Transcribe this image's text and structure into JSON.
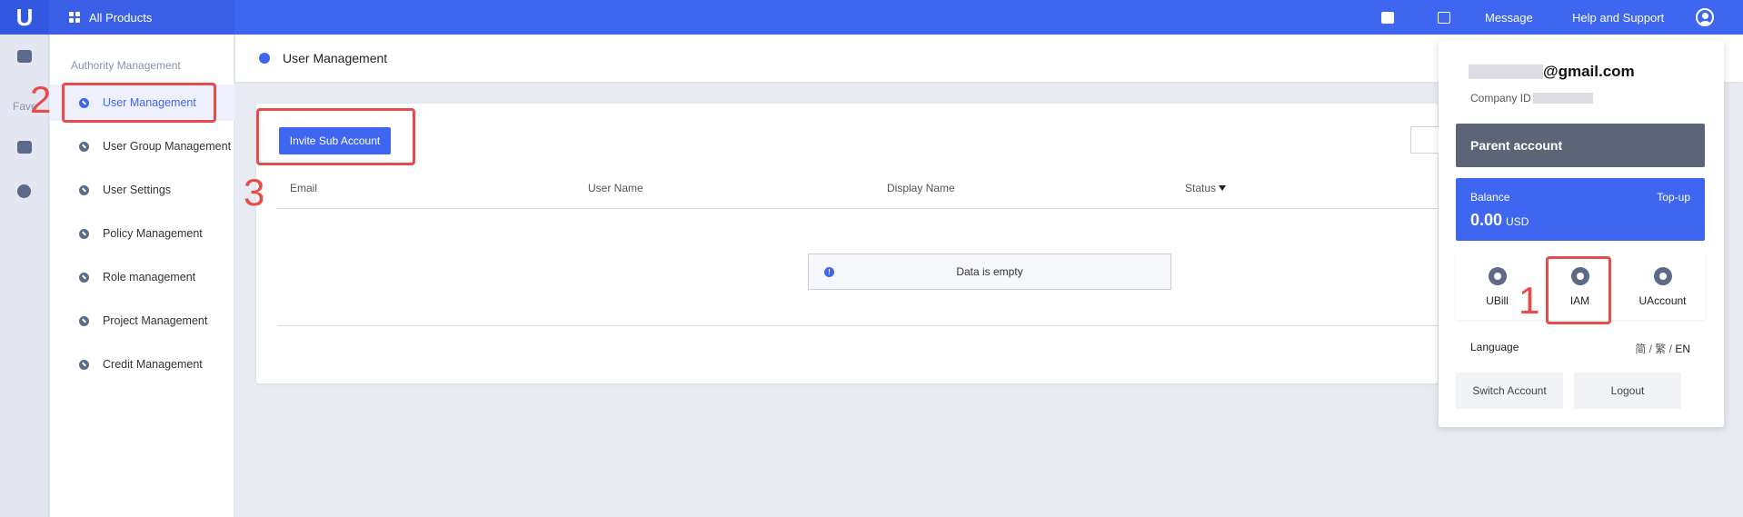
{
  "topbar": {
    "all_products": "All Products",
    "message": "Message",
    "help": "Help and Support",
    "icons": [
      "search-icon",
      "terminal-icon",
      "user-icon"
    ]
  },
  "rail": {
    "fav_label": "Fave"
  },
  "sidebar": {
    "title": "Authority Management",
    "items": [
      {
        "label": "User Management"
      },
      {
        "label": "User Group Management"
      },
      {
        "label": "User Settings"
      },
      {
        "label": "Policy Management"
      },
      {
        "label": "Role management"
      },
      {
        "label": "Project Management"
      },
      {
        "label": "Credit Management"
      }
    ]
  },
  "main": {
    "title": "User Management",
    "invite_button": "Invite Sub Account",
    "columns": [
      "Email",
      "User Name",
      "Display Name",
      "Status"
    ],
    "empty_text": "Data is empty"
  },
  "account_panel": {
    "email_suffix": "@gmail.com",
    "company_label": "Company ID",
    "parent_account": "Parent account",
    "balance_label": "Balance",
    "topup_label": "Top-up",
    "balance_amount": "0.00",
    "balance_currency": "USD",
    "services": [
      {
        "label": "UBill"
      },
      {
        "label": "IAM"
      },
      {
        "label": "UAccount"
      }
    ],
    "language_label": "Language",
    "languages": [
      "简",
      "繁",
      "EN"
    ],
    "switch_account": "Switch Account",
    "logout": "Logout"
  },
  "annotations": {
    "step1": "1",
    "step2": "2",
    "step3": "3"
  },
  "colors": {
    "primary": "#3f66f0",
    "annotation": "#e94a4a",
    "parent_account_bg": "#5c6577"
  }
}
